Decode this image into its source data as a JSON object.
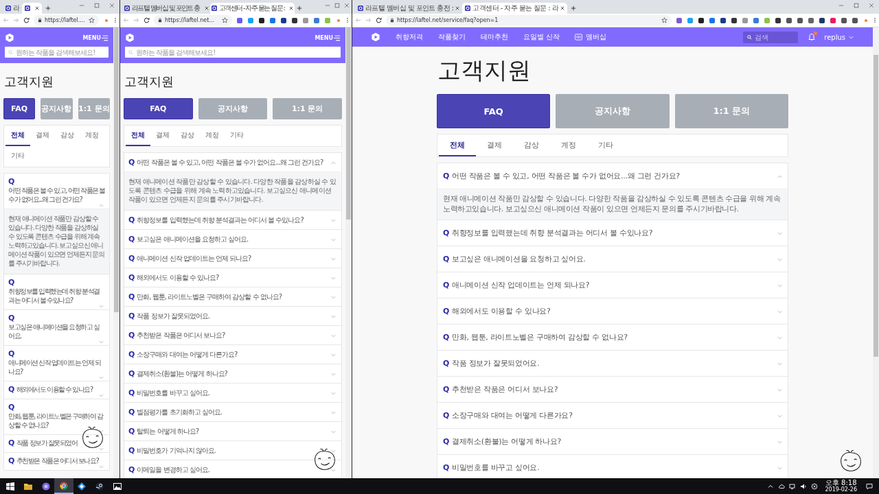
{
  "windows": [
    {
      "kind": "mobile",
      "tabs": [
        {
          "title": "라",
          "selected": false
        },
        {
          "selected": true
        }
      ],
      "url": "https://laftel....",
      "header": {
        "menu": "MENU",
        "search_placeholder": "원하는 작품을 검색해보세요!"
      },
      "page_title": "고객지원",
      "buttons": [
        {
          "label": "FAQ",
          "selected": true
        },
        {
          "label": "공지사항",
          "selected": false
        },
        {
          "label": "1:1 문의",
          "selected": false
        }
      ],
      "categories": [
        {
          "label": "전체",
          "selected": true
        },
        {
          "label": "결제",
          "selected": false
        },
        {
          "label": "감상",
          "selected": false
        },
        {
          "label": "계정",
          "selected": false
        },
        {
          "label": "기타",
          "selected": false
        }
      ],
      "faqs": [
        {
          "q": "Q",
          "question": "어떤 작품은 볼 수 있고, 어떤 작품은 볼 수가 없어요...왜 그런 건가요?",
          "expanded": true,
          "answer": "현재 애니메이션 작품만 감상할 수 있습니다. 다양한 작품을 감상하실 수 있도록 콘텐츠 수급을 위해 계속 노력하고있습니다. 보고싶으신 애니메이션 작품이 있으면 언제든지 문의를 주시기바랍니다."
        },
        {
          "q": "Q",
          "question": "취향정보를 입력했는데 취향 분석결과는 어디서 볼 수있나요?",
          "expanded": false
        },
        {
          "q": "Q",
          "question": "보고싶은 애니메이션을 요청하고 싶어요.",
          "expanded": false
        },
        {
          "q": "Q",
          "question": "애니메이션 신작 업데이트는 언제 되나요?",
          "expanded": false
        },
        {
          "q": "Q",
          "question": "해외에서도 이용할 수 있나요?",
          "expanded": false
        },
        {
          "q": "Q",
          "question": "만화, 웹툰, 라이트노벨은 구매하여 감상할 수 없나요?",
          "expanded": false
        },
        {
          "q": "Q",
          "question": "작품 정보가 잘못되었어",
          "expanded": false
        },
        {
          "q": "Q",
          "question": "추천받은 작품은 어디서 보나요?",
          "expanded": false
        }
      ]
    },
    {
      "kind": "mobile",
      "tabs": [
        {
          "title": "라프텔 멤버십 및 포인트 충",
          "selected": false
        },
        {
          "title": "고객센터 - 자주 묻는 질문 :",
          "selected": true
        }
      ],
      "url": "https://laftel.net...",
      "header": {
        "menu": "MENU",
        "search_placeholder": "원하는 작품을 검색해보세요!"
      },
      "page_title": "고객지원",
      "buttons": [
        {
          "label": "FAQ",
          "selected": true
        },
        {
          "label": "공지사항",
          "selected": false
        },
        {
          "label": "1:1 문의",
          "selected": false
        }
      ],
      "categories": [
        {
          "label": "전체",
          "selected": true
        },
        {
          "label": "결제",
          "selected": false
        },
        {
          "label": "감상",
          "selected": false
        },
        {
          "label": "계정",
          "selected": false
        },
        {
          "label": "기타",
          "selected": false
        }
      ],
      "faqs": [
        {
          "q": "Q",
          "question": "어떤 작품은 볼 수 있고, 어떤 작품은 볼 수가 없어요...왜 그런 건가요?",
          "expanded": true,
          "answer": "현재 애니메이션 작품만 감상할 수 있습니다. 다양한 작품을 감상하실 수 있도록 콘텐츠 수급을 위해 계속 노력하고있습니다. 보고싶으신 애니메이션 작품이 있으면 언제든지 문의를 주시기바랍니다."
        },
        {
          "q": "Q",
          "question": "취향정보를 입력했는데 취향 분석결과는 어디서 볼 수있나요?",
          "expanded": false
        },
        {
          "q": "Q",
          "question": "보고싶은 애니메이션을 요청하고 싶어요.",
          "expanded": false
        },
        {
          "q": "Q",
          "question": "애니메이션 신작 업데이트는 언제 되나요?",
          "expanded": false
        },
        {
          "q": "Q",
          "question": "해외에서도 이용할 수 있나요?",
          "expanded": false
        },
        {
          "q": "Q",
          "question": "만화, 웹툰, 라이트노벨은 구매하여 감상할 수 없나요?",
          "expanded": false
        },
        {
          "q": "Q",
          "question": "작품 정보가 잘못되었어요.",
          "expanded": false
        },
        {
          "q": "Q",
          "question": "추천받은 작품은 어디서 보나요?",
          "expanded": false
        },
        {
          "q": "Q",
          "question": "소장구매와 대여는 어떻게 다른가요?",
          "expanded": false
        },
        {
          "q": "Q",
          "question": "결제취소(환불)는 어떻게 하나요?",
          "expanded": false
        },
        {
          "q": "Q",
          "question": "비밀번호를 바꾸고 싶어요.",
          "expanded": false
        },
        {
          "q": "Q",
          "question": "별점평가를 초기화하고 싶어요.",
          "expanded": false
        },
        {
          "q": "Q",
          "question": "탈퇴는 어떻게 하나요?",
          "expanded": false
        },
        {
          "q": "Q",
          "question": "비밀번호가 기억나지 않아요.",
          "expanded": false
        },
        {
          "q": "Q",
          "question": "이메일을 변경하고 싶어요.",
          "expanded": false
        }
      ]
    },
    {
      "kind": "desktop",
      "tabs": [
        {
          "title": "라프텔 멤버십 및 포인트 충전 :",
          "selected": false
        },
        {
          "title": "고객센터 - 자주 묻는 질문 : 라",
          "selected": true
        }
      ],
      "url": "https://laftel.net/service/faq?open=1",
      "nav": {
        "items": [
          {
            "label": "취향저격",
            "kind": "text"
          },
          {
            "label": "작품찾기",
            "kind": "text"
          },
          {
            "label": "테마추천",
            "kind": "text"
          },
          {
            "label": "요일별 신작",
            "kind": "text"
          },
          {
            "label": "멤버십",
            "kind": "icon"
          }
        ],
        "search_placeholder": "검색",
        "has_notification": true,
        "user": "replus"
      },
      "page_title": "고객지원",
      "buttons": [
        {
          "label": "FAQ",
          "selected": true
        },
        {
          "label": "공지사항",
          "selected": false
        },
        {
          "label": "1:1 문의",
          "selected": false
        }
      ],
      "categories": [
        {
          "label": "전체",
          "selected": true
        },
        {
          "label": "결제",
          "selected": false
        },
        {
          "label": "감상",
          "selected": false
        },
        {
          "label": "계정",
          "selected": false
        },
        {
          "label": "기타",
          "selected": false
        }
      ],
      "faqs": [
        {
          "q": "Q",
          "question": "어떤 작품은 볼 수 있고, 어떤 작품은 볼 수가 없어요...왜 그런 건가요?",
          "expanded": true,
          "answer": "현재 애니메이션 작품만 감상할 수 있습니다. 다양한 작품을 감상하실 수 있도록 콘텐츠 수급을 위해 계속 노력하고있습니다. 보고싶으신 애니메이션 작품이 있으면 언제든지 문의를 주시기바랍니다."
        },
        {
          "q": "Q",
          "question": "취향정보를 입력했는데 취향 분석결과는 어디서 볼 수있나요?",
          "expanded": false
        },
        {
          "q": "Q",
          "question": "보고싶은 애니메이션을 요청하고 싶어요.",
          "expanded": false
        },
        {
          "q": "Q",
          "question": "애니메이션 신작 업데이트는 언제 되나요?",
          "expanded": false
        },
        {
          "q": "Q",
          "question": "해외에서도 이용할 수 있나요?",
          "expanded": false
        },
        {
          "q": "Q",
          "question": "만화, 웹툰, 라이트노벨은 구매하여 감상할 수 없나요?",
          "expanded": false
        },
        {
          "q": "Q",
          "question": "작품 정보가 잘못되었어요.",
          "expanded": false
        },
        {
          "q": "Q",
          "question": "추천받은 작품은 어디서 보나요?",
          "expanded": false
        },
        {
          "q": "Q",
          "question": "소장구매와 대여는 어떻게 다른가요?",
          "expanded": false
        },
        {
          "q": "Q",
          "question": "결제취소(환불)는 어떻게 하나요?",
          "expanded": false
        },
        {
          "q": "Q",
          "question": "비밀번호를 바꾸고 싶어요.",
          "expanded": false
        }
      ]
    }
  ],
  "taskbar": {
    "time": "오후 8:18",
    "date": "2019-02-26"
  }
}
